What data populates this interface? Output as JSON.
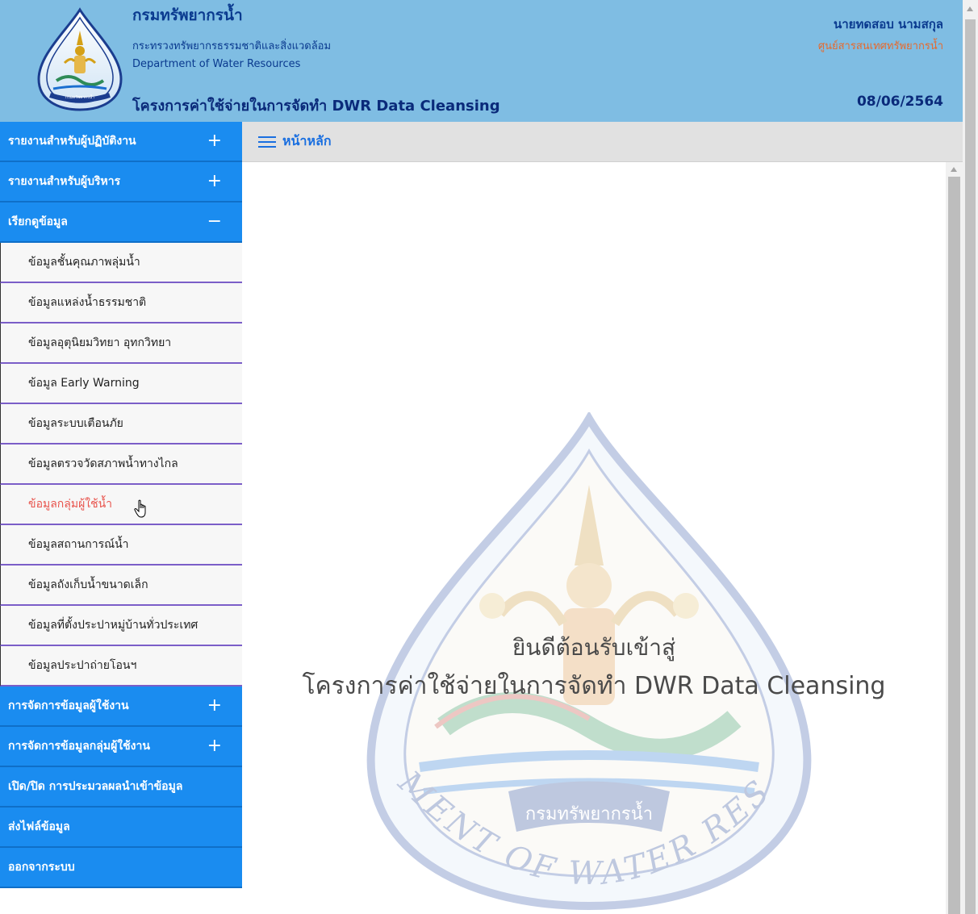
{
  "header": {
    "title": "กรมทรัพยากรน้ำ",
    "ministry": "กระทรวงทรัพยากรธรรมชาติและสิ่งแวดล้อม",
    "department_en": "Department of Water Resources",
    "project": "โครงการค่าใช้จ่ายในการจัดทำ DWR Data Cleansing",
    "user_name": "นายทดสอบ นามสกุล",
    "user_unit": "ศูนย์สารสนเทศทรัพยากรน้ำ",
    "date": "08/06/2564",
    "logo_text": "DEPARTMENT OF WATER RESOURCES"
  },
  "topbar": {
    "title": "หน้าหลัก",
    "menu_icon": "hamburger-icon"
  },
  "sidebar": {
    "items": [
      {
        "label": "รายงานสำหรับผู้ปฏิบัติงาน",
        "type": "main",
        "toggle": "+"
      },
      {
        "label": "รายงานสำหรับผู้บริหาร",
        "type": "main",
        "toggle": "+"
      },
      {
        "label": "เรียกดูข้อมูล",
        "type": "main",
        "toggle": "−"
      },
      {
        "label": "ข้อมูลชั้นคุณภาพลุ่มน้ำ",
        "type": "sub"
      },
      {
        "label": "ข้อมูลแหล่งน้ำธรรมชาติ",
        "type": "sub"
      },
      {
        "label": "ข้อมูลอุตุนิยมวิทยา อุทกวิทยา",
        "type": "sub"
      },
      {
        "label": "ข้อมูล Early Warning",
        "type": "sub"
      },
      {
        "label": "ข้อมูลระบบเตือนภัย",
        "type": "sub"
      },
      {
        "label": "ข้อมูลตรวจวัดสภาพน้ำทางไกล",
        "type": "sub"
      },
      {
        "label": "ข้อมูลกลุ่มผู้ใช้น้ำ",
        "type": "sub",
        "active": true
      },
      {
        "label": "ข้อมูลสถานการณ์น้ำ",
        "type": "sub"
      },
      {
        "label": "ข้อมูลถังเก็บน้ำขนาดเล็ก",
        "type": "sub"
      },
      {
        "label": "ข้อมูลที่ตั้งประปาหมู่บ้านทั่วประเทศ",
        "type": "sub"
      },
      {
        "label": "ข้อมูลประปาถ่ายโอนฯ",
        "type": "sub"
      },
      {
        "label": "การจัดการข้อมูลผู้ใช้งาน",
        "type": "main",
        "toggle": "+"
      },
      {
        "label": "การจัดการข้อมูลกลุ่มผู้ใช้งาน",
        "type": "main",
        "toggle": "+"
      },
      {
        "label": "เปิด/ปิด การประมวลผลนำเข้าข้อมูล",
        "type": "main",
        "toggle": ""
      },
      {
        "label": "ส่งไฟล์ข้อมูล",
        "type": "main",
        "toggle": ""
      },
      {
        "label": "ออกจากระบบ",
        "type": "main",
        "toggle": ""
      }
    ]
  },
  "content": {
    "welcome_line1": "ยินดีต้อนรับเข้าสู่",
    "welcome_line2": "โครงการค่าใช้จ่ายในการจัดทำ DWR Data Cleansing",
    "watermark_text_th": "กรมทรัพยากรน้ำ",
    "watermark_text_en": "DEPARTMENT OF WATER RESOURCES"
  },
  "colors": {
    "header_bg": "#7fbde3",
    "menu_main_bg": "#1a8cf0",
    "menu_sub_border": "#7b5ec8",
    "active_link": "#e8534c",
    "topbar_title": "#1a6fe0"
  }
}
